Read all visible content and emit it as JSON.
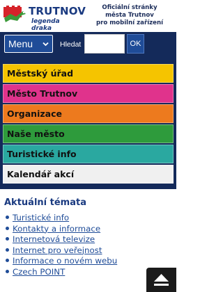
{
  "header": {
    "logo_name": "TRUTNOV",
    "logo_subtitle": "legenda draka",
    "tagline_lines": [
      "Oficiální stránky",
      "města Trutnov",
      "pro mobilní zařízení"
    ]
  },
  "searchbar": {
    "menu_label": "Menu",
    "search_label": "Hledat",
    "search_value": "",
    "ok_label": "OK"
  },
  "nav": {
    "items": [
      {
        "label": "Městský úřad",
        "color": "#f5c400"
      },
      {
        "label": "Město Trutnov",
        "color": "#e0338c"
      },
      {
        "label": "Organizace",
        "color": "#ed7a1e"
      },
      {
        "label": "Naše město",
        "color": "#2e9b3c"
      },
      {
        "label": "Turistické  info",
        "color": "#2aa8a0"
      },
      {
        "label": "Kalendář  akcí",
        "color": "#f0f0f0"
      }
    ]
  },
  "topics": {
    "title": "Aktuální témata",
    "items": [
      "Turistické info",
      "Kontakty a informace",
      "Internetová televize",
      "Internet pro veřejnost",
      "Informace o novém webu",
      "Czech POINT"
    ]
  },
  "colors": {
    "navy": "#142a5a",
    "accent_blue": "#1f4c98",
    "title_blue": "#1a3a80"
  },
  "icons": {
    "logo": "trutnov-dragon-logo",
    "menu_caret": "chevron-down-icon",
    "scroll_top": "arrow-up-icon"
  }
}
